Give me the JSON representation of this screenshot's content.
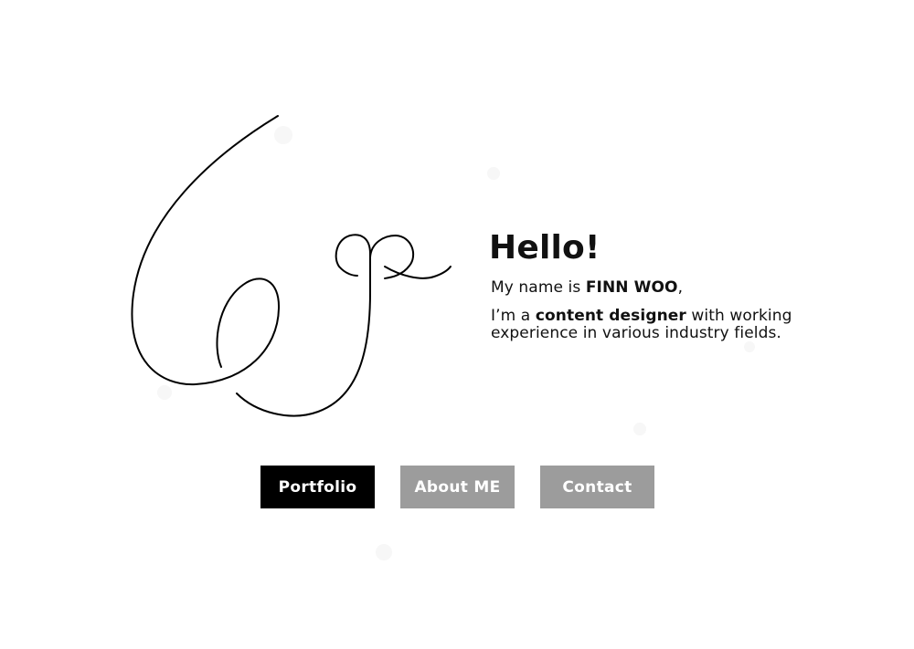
{
  "hero": {
    "greeting": "Hello!",
    "name_prefix": "My name is ",
    "name": "FINN WOO",
    "name_suffix": ",",
    "role_prefix": "I’m a ",
    "role": "content designer",
    "role_suffix": " with working experience in various industry fields."
  },
  "nav": {
    "portfolio": "Portfolio",
    "about": "About ME",
    "contact": "Contact"
  },
  "colors": {
    "primary_button": "#000000",
    "secondary_button": "#9c9c9c",
    "text": "#111111",
    "background": "#ffffff"
  },
  "icons": {
    "logo": "handwritten-signature-logo"
  }
}
